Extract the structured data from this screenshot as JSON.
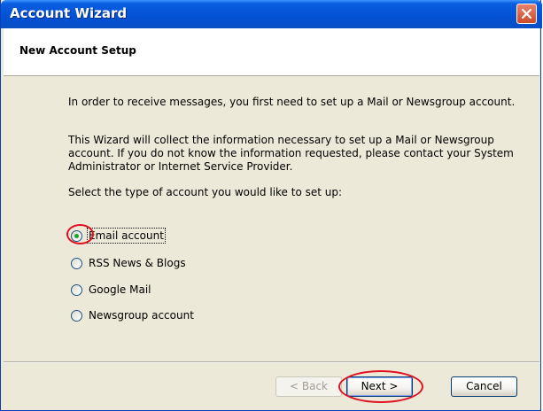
{
  "window": {
    "title": "Account Wizard"
  },
  "header": {
    "title": "New Account Setup"
  },
  "body": {
    "intro": "In order to receive messages, you first need to set up a Mail or Newsgroup account.",
    "info": "This Wizard will collect the information necessary to set up a Mail or Newsgroup account. If you do not know the information requested, please contact your System Administrator or Internet Service Provider.",
    "prompt": "Select the type of account you would like to set up:"
  },
  "options": [
    {
      "label": "Email account",
      "selected": true
    },
    {
      "label": "RSS News & Blogs",
      "selected": false
    },
    {
      "label": "Google Mail",
      "selected": false
    },
    {
      "label": "Newsgroup account",
      "selected": false
    }
  ],
  "buttons": {
    "back": "< Back",
    "next": "Next >",
    "cancel": "Cancel"
  },
  "colors": {
    "titlebar": "#0454d8",
    "highlight": "#e01020",
    "radio_selected": "#21a121"
  }
}
